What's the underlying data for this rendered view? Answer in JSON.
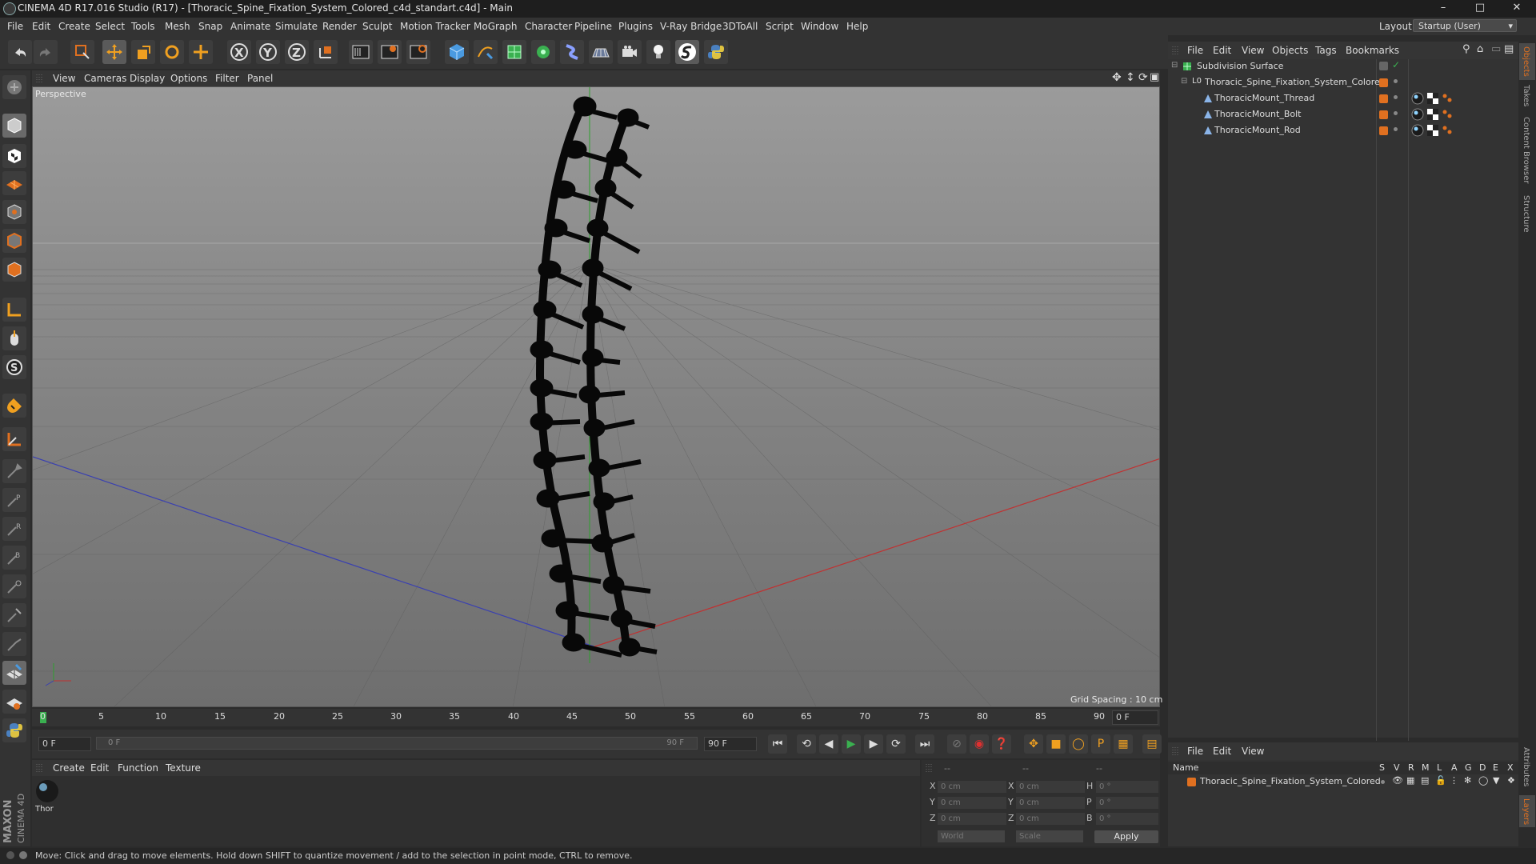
{
  "window": {
    "title": "CINEMA 4D R17.016 Studio (R17) - [Thoracic_Spine_Fixation_System_Colored_c4d_standart.c4d] - Main",
    "minimize": "–",
    "maximize": "□",
    "close": "✕"
  },
  "menu": [
    "File",
    "Edit",
    "Create",
    "Select",
    "Tools",
    "Mesh",
    "Snap",
    "Animate",
    "Simulate",
    "Render",
    "Sculpt",
    "Motion Tracker",
    "MoGraph",
    "Character",
    "Pipeline",
    "Plugins",
    "V-Ray Bridge",
    "3DToAll",
    "Script",
    "Window",
    "Help"
  ],
  "layout": {
    "label": "Layout:",
    "value": "Startup (User)"
  },
  "viewport": {
    "menu": [
      "View",
      "Cameras",
      "Display",
      "Options",
      "Filter",
      "Panel"
    ],
    "camera_label": "Perspective",
    "grid_spacing": "Grid Spacing : 10 cm"
  },
  "timeline": {
    "ticks": [
      "0",
      "5",
      "10",
      "15",
      "20",
      "25",
      "30",
      "35",
      "40",
      "45",
      "50",
      "55",
      "60",
      "65",
      "70",
      "75",
      "80",
      "85",
      "90"
    ],
    "current_frame": "0 F",
    "start_frame": "0 F",
    "range_start": "0 F",
    "range_end": "90 F",
    "end_frame": "90 F"
  },
  "material_manager": {
    "menu": [
      "Create",
      "Edit",
      "Function",
      "Texture"
    ],
    "material_name": "Thor"
  },
  "coordinates": {
    "header_left": "--",
    "header_mid": "--",
    "header_right": "--",
    "rows": [
      {
        "a": "X",
        "av": "0 cm",
        "b": "X",
        "bv": "0 cm",
        "c": "H",
        "cv": "0 °"
      },
      {
        "a": "Y",
        "av": "0 cm",
        "b": "Y",
        "bv": "0 cm",
        "c": "P",
        "cv": "0 °"
      },
      {
        "a": "Z",
        "av": "0 cm",
        "b": "Z",
        "bv": "0 cm",
        "c": "B",
        "cv": "0 °"
      }
    ],
    "space": "World",
    "mode": "Scale",
    "apply": "Apply"
  },
  "object_manager": {
    "menu": [
      "File",
      "Edit",
      "View",
      "Objects",
      "Tags",
      "Bookmarks"
    ],
    "objects": [
      {
        "name": "Subdivision Surface",
        "indent": 0
      },
      {
        "name": "Thoracic_Spine_Fixation_System_Colored",
        "indent": 1
      },
      {
        "name": "ThoracicMount_Thread",
        "indent": 2
      },
      {
        "name": "ThoracicMount_Bolt",
        "indent": 2
      },
      {
        "name": "ThoracicMount_Rod",
        "indent": 2
      }
    ]
  },
  "layer_manager": {
    "menu": [
      "File",
      "Edit",
      "View"
    ],
    "columns": [
      "Name",
      "S",
      "V",
      "R",
      "M",
      "L",
      "A",
      "G",
      "D",
      "E",
      "X"
    ],
    "row": "Thoracic_Spine_Fixation_System_Colored"
  },
  "side_tabs": [
    "Objects",
    "Takes",
    "Content Browser",
    "Structure",
    "Attributes",
    "Layers"
  ],
  "status": "Move: Click and drag to move elements. Hold down SHIFT to quantize movement / add to the selection in point mode, CTRL to remove.",
  "branding": {
    "maxon": "MAXON",
    "c4d": "CINEMA 4D"
  },
  "colors": {
    "accent_orange": "#e07020",
    "axis_x": "#c03030",
    "axis_z": "#3040b0",
    "axis_y": "#30a030"
  }
}
